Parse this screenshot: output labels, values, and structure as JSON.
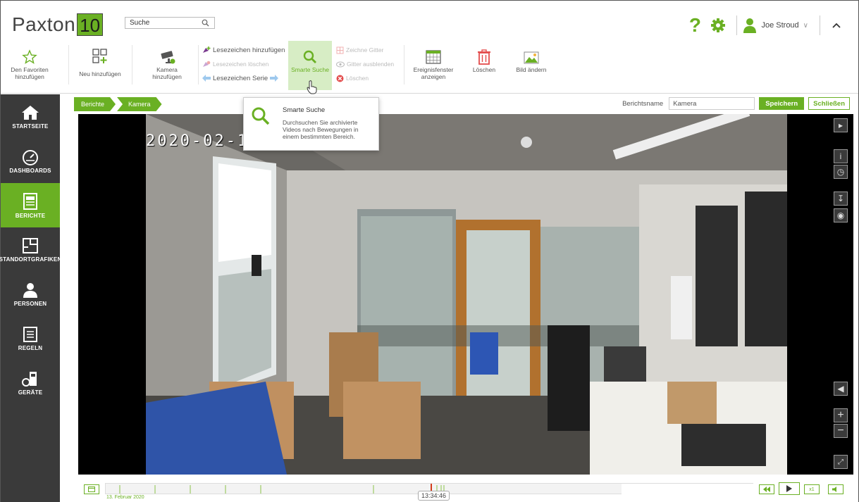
{
  "app": {
    "logo_text": "Paxton",
    "logo_version": "10"
  },
  "search": {
    "value": "Suche"
  },
  "user": {
    "name": "Joe Stroud"
  },
  "toolbar": {
    "favorites": "Den Favoriten hinzufügen",
    "new": "Neu hinzufügen",
    "camera": "Kamera hinzufügen",
    "bookmark_add": "Lesezeichen hinzufügen",
    "bookmark_delete": "Lesezeichen löschen",
    "bookmark_series": "Lesezeichen Serie",
    "smart_search": "Smarte Suche",
    "draw_grid": "Zeichne Gitter",
    "hide_grid": "Gitter ausblenden",
    "delete_small": "Löschen",
    "event_window": "Ereignisfenster anzeigen",
    "delete": "Löschen",
    "change_image": "Bild ändern"
  },
  "sidebar": {
    "items": [
      {
        "label": "STARTSEITE"
      },
      {
        "label": "DASHBOARDS"
      },
      {
        "label": "BERICHTE"
      },
      {
        "label": "STANDORTGRAFIKEN"
      },
      {
        "label": "PERSONEN"
      },
      {
        "label": "REGELN"
      },
      {
        "label": "GERÄTE"
      }
    ]
  },
  "breadcrumb": {
    "items": [
      "Berichte",
      "Kamera"
    ]
  },
  "report": {
    "label": "Berichtsname",
    "value": "Kamera",
    "save": "Speichern",
    "close": "Schließen"
  },
  "video": {
    "osd": "2020-02-1"
  },
  "timeline": {
    "date": "13. Februar 2020",
    "time": "13:34:46",
    "speed": "x1"
  },
  "tooltip": {
    "title": "Smarte Suche",
    "body": "Durchsuchen Sie archivierte Videos nach Bewegungen in einem bestimmten Bereich."
  },
  "colors": {
    "accent": "#6ab023",
    "sidebar": "#3a3a3a"
  }
}
